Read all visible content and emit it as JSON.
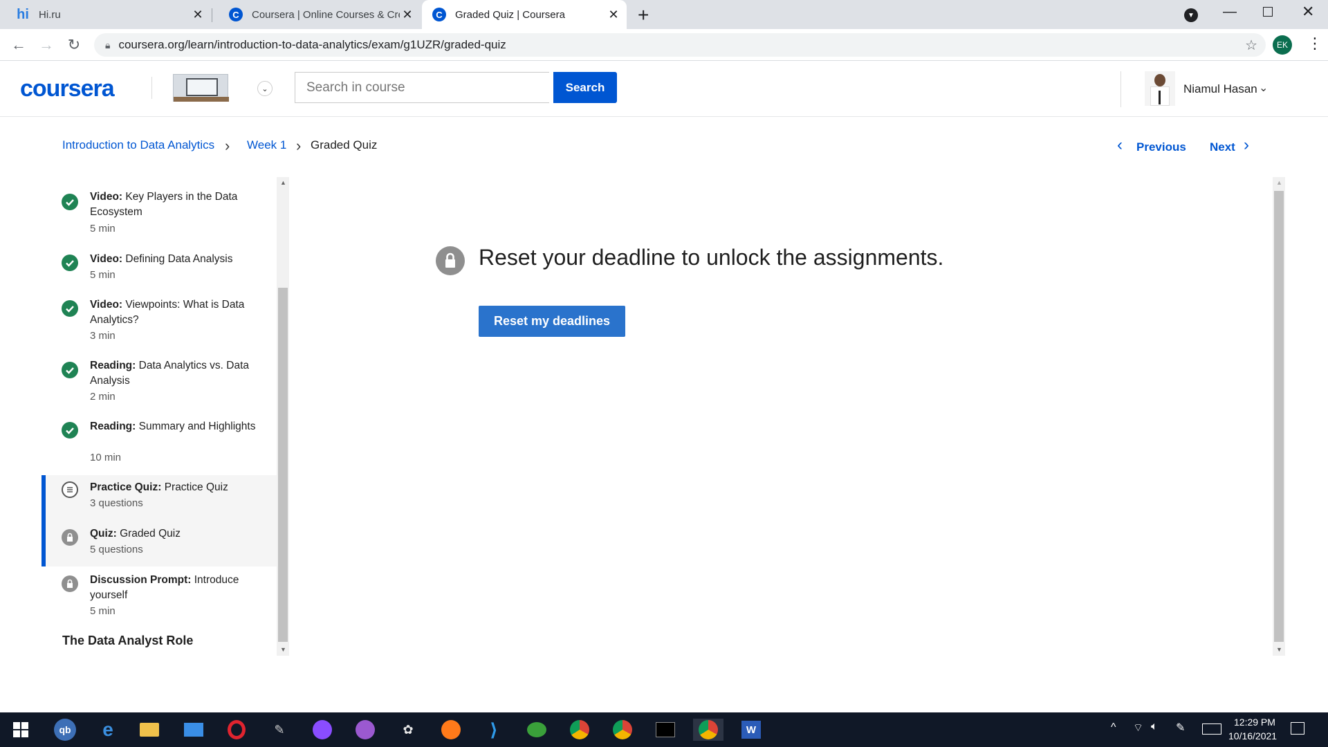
{
  "browser": {
    "tabs": [
      {
        "title": "Hi.ru",
        "icon": "hi-ru-icon"
      },
      {
        "title": "Coursera | Online Courses & Cre",
        "icon": "coursera-icon"
      },
      {
        "title": "Graded Quiz | Coursera",
        "icon": "coursera-icon",
        "active": true
      }
    ],
    "url": "coursera.org/learn/introduction-to-data-analytics/exam/g1UZR/graded-quiz",
    "profile_initials": "EK"
  },
  "header": {
    "logo": "coursera",
    "search_placeholder": "Search in course",
    "search_button": "Search",
    "user_name": "Niamul Hasan"
  },
  "breadcrumb": {
    "course": "Introduction to Data Analytics",
    "week": "Week 1",
    "current": "Graded Quiz",
    "previous": "Previous",
    "next": "Next"
  },
  "sidebar": {
    "items": [
      {
        "type": "Video:",
        "title": "Key Players in the Data Ecosystem",
        "duration": "5 min",
        "status": "done"
      },
      {
        "type": "Video:",
        "title": "Defining Data Analysis",
        "duration": "5 min",
        "status": "done"
      },
      {
        "type": "Video:",
        "title": "Viewpoints: What is Data Analytics?",
        "duration": "3 min",
        "status": "done"
      },
      {
        "type": "Reading:",
        "title": "Data Analytics vs. Data Analysis",
        "duration": "2 min",
        "status": "done"
      },
      {
        "type": "Reading:",
        "title": "Summary and Highlights",
        "duration": "10 min",
        "status": "done"
      },
      {
        "type": "Practice Quiz:",
        "title": "Practice Quiz",
        "duration": "3 questions",
        "status": "quiz"
      },
      {
        "type": "Quiz:",
        "title": "Graded Quiz",
        "duration": "5 questions",
        "status": "locked"
      },
      {
        "type": "Discussion Prompt:",
        "title": "Introduce yourself",
        "duration": "5 min",
        "status": "locked"
      }
    ],
    "section_heading": "The Data Analyst Role"
  },
  "main": {
    "headline": "Reset your deadline to unlock the assignments.",
    "reset_button": "Reset my deadlines"
  },
  "taskbar": {
    "time": "12:29 PM",
    "date": "10/16/2021"
  },
  "colors": {
    "brand": "#0056d2",
    "done_green": "#1f8354",
    "lock_gray": "#8f8f8f",
    "taskbar": "#101827"
  }
}
